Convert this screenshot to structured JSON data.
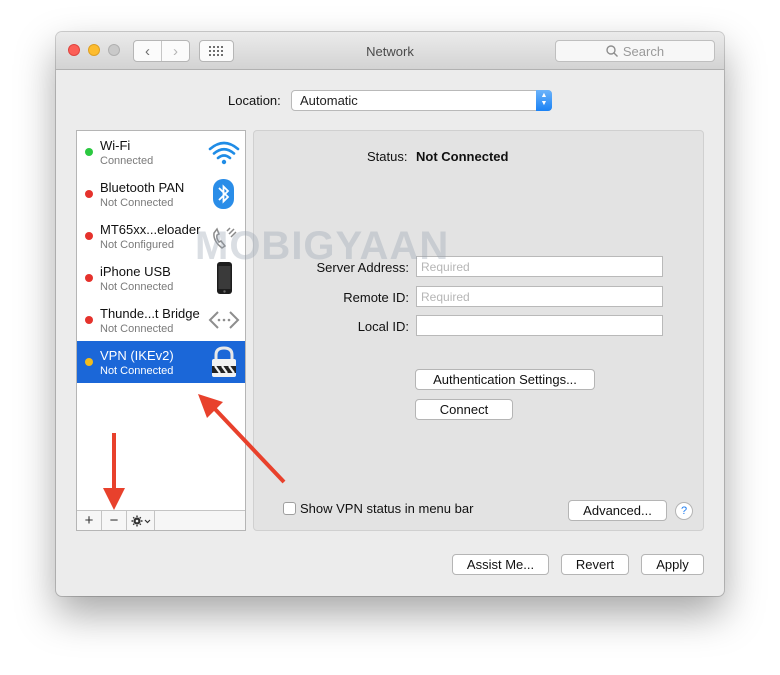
{
  "window": {
    "title": "Network"
  },
  "search": {
    "placeholder": "Search"
  },
  "location": {
    "label": "Location:",
    "value": "Automatic"
  },
  "services": [
    {
      "name": "Wi-Fi",
      "status": "Connected",
      "dot_color": "#2bc840",
      "icon": "wifi-icon"
    },
    {
      "name": "Bluetooth PAN",
      "status": "Not Connected",
      "dot_color": "#e5322c",
      "icon": "bluetooth-icon"
    },
    {
      "name": "MT65xx...eloader",
      "status": "Not Configured",
      "dot_color": "#e5322c",
      "icon": "phone-handset-icon"
    },
    {
      "name": "iPhone USB",
      "status": "Not Connected",
      "dot_color": "#e5322c",
      "icon": "iphone-icon"
    },
    {
      "name": "Thunde...t Bridge",
      "status": "Not Connected",
      "dot_color": "#e5322c",
      "icon": "thunderbolt-bridge-icon"
    },
    {
      "name": "VPN (IKEv2)",
      "status": "Not Connected",
      "dot_color": "#f2bc1c",
      "icon": "lock-icon",
      "selected": true
    }
  ],
  "detail": {
    "status_label": "Status:",
    "status_value": "Not Connected",
    "server_label": "Server Address:",
    "server_placeholder": "Required",
    "remote_label": "Remote ID:",
    "remote_placeholder": "Required",
    "local_label": "Local ID:",
    "auth_button": "Authentication Settings...",
    "connect_button": "Connect",
    "show_status_label": "Show VPN status in menu bar",
    "advanced_button": "Advanced...",
    "help": "?"
  },
  "footer": {
    "assist": "Assist Me...",
    "revert": "Revert",
    "apply": "Apply"
  },
  "sidebar_footer": {
    "add": "+",
    "remove": "−"
  },
  "watermark": "MOBIGYAAN",
  "colors": {
    "accent": "#1b67d8",
    "arrow": "#e8412c"
  }
}
